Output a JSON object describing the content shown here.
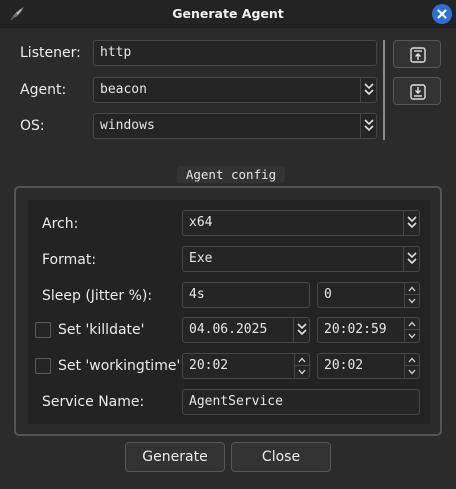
{
  "window": {
    "title": "Generate Agent",
    "icons": {
      "app": "feather-quill-icon",
      "close": "close-icon"
    },
    "accent": "#2d6fd6"
  },
  "listener": {
    "label": "Listener:",
    "value": "http"
  },
  "agent": {
    "label": "Agent:",
    "value": "beacon"
  },
  "os": {
    "label": "OS:",
    "value": "windows"
  },
  "side_buttons": {
    "load_icon": "upload-icon",
    "save_icon": "download-icon"
  },
  "agent_config": {
    "title": "Agent config",
    "arch": {
      "label": "Arch:",
      "value": "x64"
    },
    "format": {
      "label": "Format:",
      "value": "Exe"
    },
    "sleep": {
      "label": "Sleep (Jitter %):",
      "value": "4s",
      "jitter": "0"
    },
    "killdate": {
      "label": "Set 'killdate'",
      "checked": false,
      "date": "04.06.2025",
      "time": "20:02:59"
    },
    "workingtime": {
      "label": "Set 'workingtime'",
      "checked": false,
      "start": "20:02",
      "end": "20:02"
    },
    "service_name": {
      "label": "Service Name:",
      "value": "AgentService"
    }
  },
  "buttons": {
    "generate": "Generate",
    "close": "Close"
  }
}
